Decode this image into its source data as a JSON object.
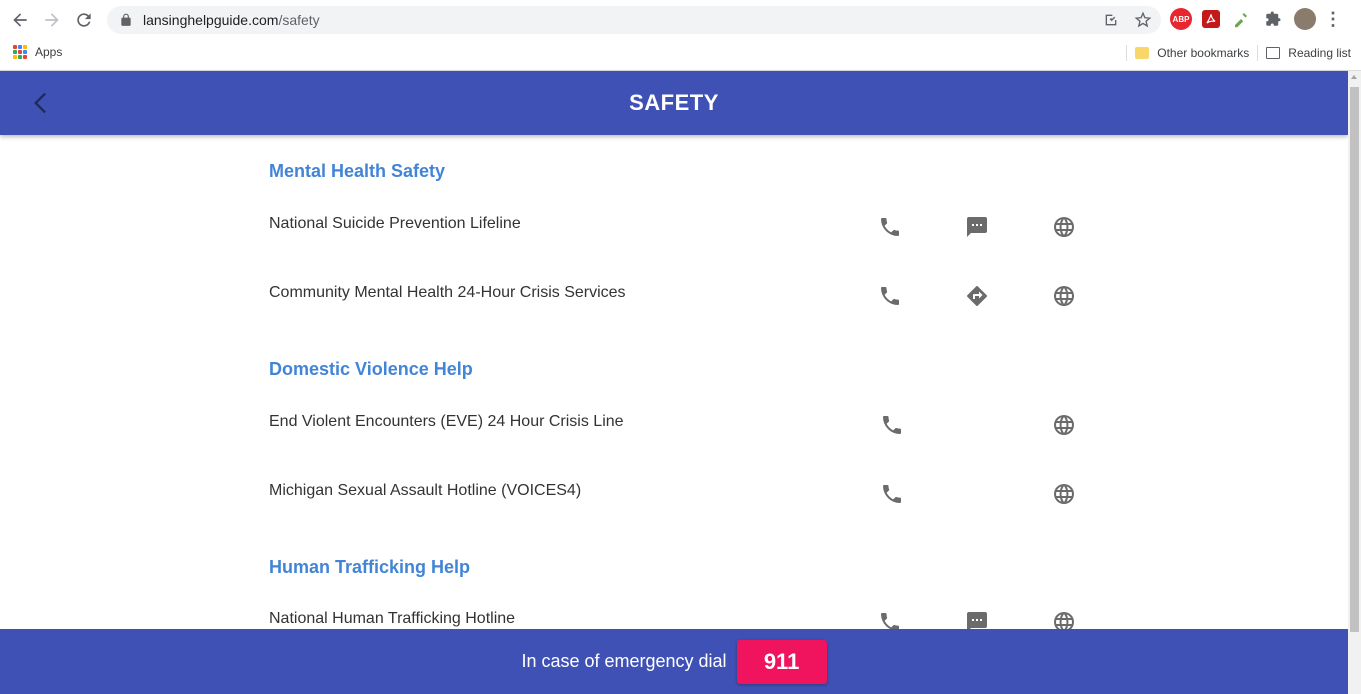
{
  "browser": {
    "url_domain": "lansinghelpguide.com",
    "url_path": "/safety",
    "bookmarks": {
      "apps_label": "Apps",
      "other_label": "Other bookmarks",
      "reading_label": "Reading list"
    },
    "extensions": {
      "abp_label": "ABP"
    }
  },
  "header": {
    "title": "SAFETY"
  },
  "sections": [
    {
      "title": "Mental Health Safety",
      "items": [
        {
          "label": "National Suicide Prevention Lifeline",
          "actions": [
            "phone-icon",
            "message-icon",
            "globe-icon"
          ]
        },
        {
          "label": "Community Mental Health 24-Hour Crisis Services",
          "actions": [
            "phone-icon",
            "directions-icon",
            "globe-icon"
          ]
        }
      ]
    },
    {
      "title": "Domestic Violence Help",
      "items": [
        {
          "label": "End Violent Encounters (EVE) 24 Hour Crisis Line",
          "actions": [
            "phone-icon",
            "globe-icon"
          ]
        },
        {
          "label": "Michigan Sexual Assault Hotline (VOICES4)",
          "actions": [
            "phone-icon",
            "globe-icon"
          ]
        }
      ]
    },
    {
      "title": "Human Trafficking Help",
      "items": [
        {
          "label": "National Human Trafficking Hotline",
          "actions": [
            "phone-icon",
            "message-icon",
            "globe-icon"
          ]
        }
      ]
    }
  ],
  "footer": {
    "text": "In case of emergency dial",
    "number": "911"
  },
  "colors": {
    "primary": "#3f51b5",
    "section_title": "#4285d6",
    "emergency": "#f0135d"
  }
}
